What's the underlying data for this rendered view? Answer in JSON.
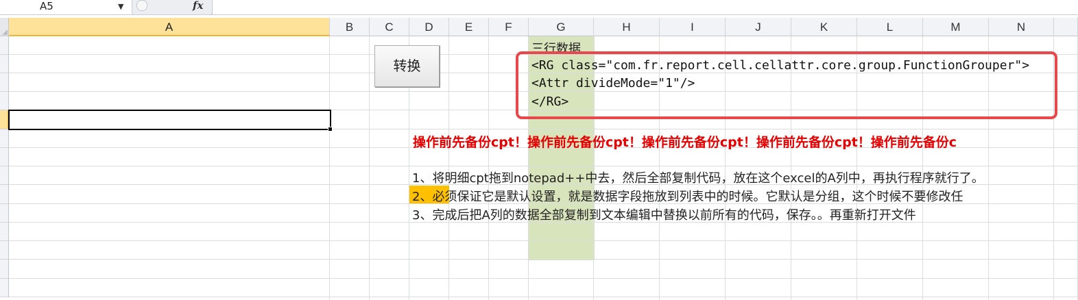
{
  "formula_bar": {
    "name_box": "A5",
    "fx_label": "fx"
  },
  "columns": [
    "A",
    "B",
    "C",
    "D",
    "E",
    "F",
    "G",
    "H",
    "I",
    "J",
    "K",
    "L",
    "M",
    "N"
  ],
  "selected_column": "A",
  "active_cell": "A5",
  "button": {
    "label": "转换"
  },
  "cells": {
    "g_header": "三行数据",
    "code_lines": [
      "<RG class=\"com.fr.report.cell.cellattr.core.group.FunctionGrouper\">",
      "<Attr divideMode=\"1\"/>",
      "</RG>"
    ],
    "warning": "操作前先备份cpt！操作前先备份cpt！操作前先备份cpt！操作前先备份cpt！操作前先备份c",
    "instructions": [
      "1、将明细cpt拖到notepad++中去，然后全部复制代码，放在这个excel的A列中，再执行程序就行了。",
      "2、必须保证它是默认设置，就是数据字段拖放到列表中的时候。它默认是分组，这个时候不要修改任",
      "3、完成后把A列的数据全部复制到文本编辑中替换以前所有的代码，保存。。再重新打开文件"
    ]
  },
  "colors": {
    "selection_header": "#ffe29a",
    "column_g_fill": "#d8e4bc",
    "callout_border": "#e8474b",
    "warning_text": "#e80000",
    "highlight": "#ffc000"
  }
}
